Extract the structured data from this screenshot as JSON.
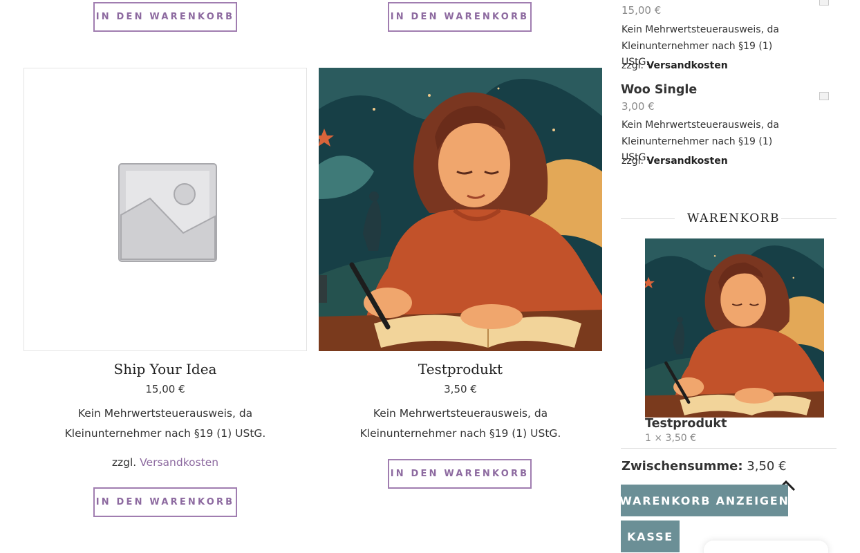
{
  "products": [
    {
      "title": "Ship Your Idea",
      "price": "15,00 €",
      "tax_note": "Kein Mehrwertsteuerausweis, da Kleinunternehmer nach §19 (1) UStG.",
      "shipping_prefix": "zzgl.",
      "shipping_link": "Versandkosten",
      "add_to_cart": "IN DEN WARENKORB",
      "image": "placeholder-image-icon"
    },
    {
      "title": "Testprodukt",
      "price": "3,50 €",
      "tax_note": "Kein Mehrwertsteuerausweis, da Kleinunternehmer nach §19 (1) UStG.",
      "add_to_cart": "IN DEN WARENKORB",
      "image": "woman-writing-illustration"
    }
  ],
  "top_row_buttons": [
    "IN DEN WARENKORB",
    "IN DEN WARENKORB"
  ],
  "sidebar": {
    "products": [
      {
        "title": "",
        "price": "15,00 €",
        "tax_note": "Kein Mehrwertsteuerausweis, da Kleinunternehmer nach §19 (1) UStG.",
        "shipping_prefix": "zzgl.",
        "shipping_link": "Versandkosten"
      },
      {
        "title": "Woo Single",
        "price": "3,00 €",
        "tax_note": "Kein Mehrwertsteuerausweis, da Kleinunternehmer nach §19 (1) UStG.",
        "shipping_prefix": "zzgl.",
        "shipping_link": "Versandkosten"
      }
    ],
    "cart": {
      "heading": "WARENKORB",
      "item_title": "Testprodukt",
      "item_qty_price": "1 × 3,50 €",
      "subtotal_label": "Zwischensumme:",
      "subtotal_value": "3,50 €",
      "view_cart": "WARENKORB ANZEIGEN",
      "checkout": "KASSE"
    }
  },
  "scroll_top_icon": "chevron-up-icon",
  "colors": {
    "accent": "#8d6aa0",
    "button": "#6b8f96",
    "text": "#333333"
  }
}
